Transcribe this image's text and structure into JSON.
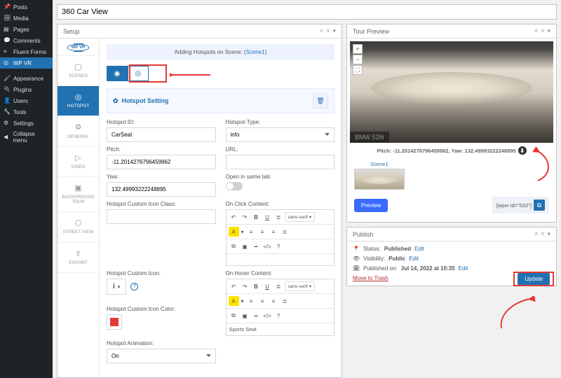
{
  "wp_menu": {
    "posts": "Posts",
    "media": "Media",
    "pages": "Pages",
    "comments": "Comments",
    "fluent": "Fluent Forms",
    "wpvr": "WP VR",
    "appearance": "Appearance",
    "plugins": "Plugins",
    "users": "Users",
    "tools": "Tools",
    "settings": "Settings",
    "collapse": "Collapse menu"
  },
  "title": "360 Car View",
  "panels": {
    "setup": "Setup",
    "preview": "Tour Preview",
    "publish": "Publish"
  },
  "logo": "WP VR",
  "vtabs": {
    "scenes": "SCENES",
    "hotspot": "HOTSPOT",
    "general": "GENERAL",
    "video": "VIDEO",
    "bg": "BACKGROUND TOUR",
    "street": "STREET VIEW",
    "export": "EXPORT"
  },
  "banner": {
    "pre": "Adding Hotspots on Scene: ",
    "link": "(Scene1)"
  },
  "section": {
    "title": "Hotspot Setting"
  },
  "form": {
    "hotspot_id_lbl": "Hotspot ID:",
    "hotspot_id_val": "CarSeat",
    "hotspot_type_lbl": "Hotspot-Type:",
    "hotspot_type_val": "info",
    "pitch_lbl": "Pitch:",
    "pitch_val": "-11.2014276796459962",
    "url_lbl": "URL:",
    "url_val": "",
    "yaw_lbl": "Yaw:",
    "yaw_val": "132.49993222248895",
    "open_lbl": "Open in same tab:",
    "icon_class_lbl": "Hotspot Custom Icon Class:",
    "icon_class_val": "",
    "click_lbl": "On Click Content:",
    "hover_lbl": "On Hover Content:",
    "icon_lbl": "Hotspot Custom Icon:",
    "color_lbl": "Hotspot Custom Icon Color:",
    "anim_lbl": "Hotspot Animation:",
    "anim_val": "On",
    "hover_text": "Sports Seat",
    "font_sel": "sans-serif"
  },
  "preview": {
    "label": "BMW 528i",
    "coords": "Pitch: -11.2014276796459962, Yaw: 132.49993222248895",
    "scene": "Scene1",
    "btn": "Preview",
    "shortcode": "[wpvr id=\"532\"]"
  },
  "publish": {
    "status_lbl": "Status:",
    "status_val": "Published",
    "edit": "Edit",
    "vis_lbl": "Visibility:",
    "vis_val": "Public",
    "pub_lbl": "Published on:",
    "pub_val": "Jul 14, 2022 at 10:35",
    "trash": "Move to Trash",
    "update": "Update"
  }
}
